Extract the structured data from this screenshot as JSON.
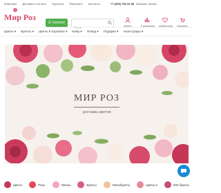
{
  "topbar": {
    "links": [
      "Компания",
      "Доставка и оплата",
      "Гарантии",
      "Реквизиты",
      "Контакты"
    ],
    "phone": "+7 (930) 754 41 58",
    "callback": "Заказать звонок"
  },
  "header": {
    "logo": "Мир Роз",
    "catalog_label": "Каталог",
    "search_placeholder": "Поиск",
    "icons": [
      {
        "icon": "login-icon",
        "label": "Войти"
      },
      {
        "icon": "compare-icon",
        "label": "Сравнение"
      },
      {
        "icon": "favorites-icon",
        "label": "Избранное"
      },
      {
        "icon": "cart-icon",
        "label": "Корзина"
      }
    ]
  },
  "nav": {
    "items": [
      "Цветы",
      "Букеты",
      "Цветы в коробках",
      "Кому",
      "Повод",
      "Подарки",
      "Аксессуары"
    ]
  },
  "banner": {
    "title": "МИР РОЗ",
    "subtitle": "доставка цветов"
  },
  "categories": [
    {
      "label": "Цветы",
      "color": "#c7385a"
    },
    {
      "label": "Розы",
      "color": "#e44a5e"
    },
    {
      "label": "Пионы",
      "color": "#f2a8b8"
    },
    {
      "label": "Букеты",
      "color": "#d35f87"
    },
    {
      "label": "Монобукеты",
      "color": "#f0c4a0"
    },
    {
      "label": "Цветы в",
      "color": "#e38a9a"
    },
    {
      "label": "MIX букеты",
      "color": "#c54c6e"
    }
  ],
  "colors": {
    "brand": "#d8476a",
    "catalog": "#4fb04a",
    "chat": "#1a8ad8"
  }
}
